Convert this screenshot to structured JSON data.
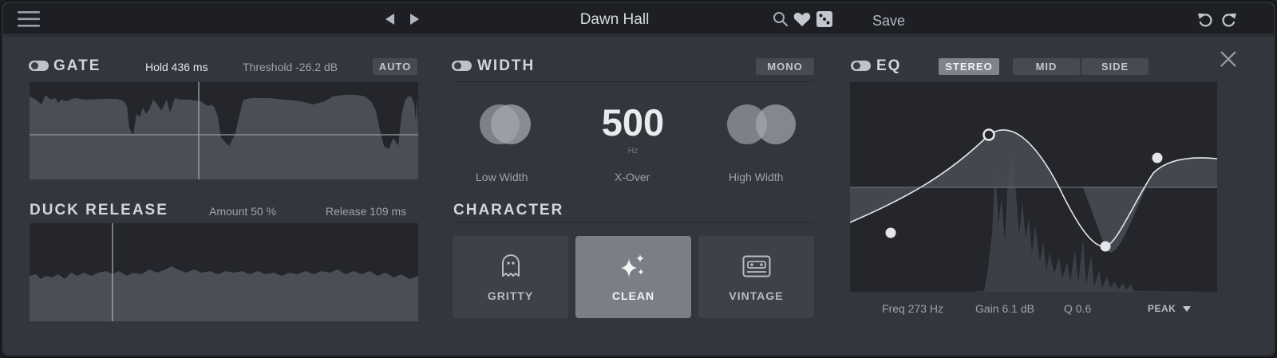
{
  "topbar": {
    "preset_name": "Dawn Hall",
    "save_label": "Save",
    "icons": [
      "menu-icon",
      "prev-preset-icon",
      "next-preset-icon",
      "search-icon",
      "heart-icon",
      "dice-icon",
      "undo-icon",
      "redo-icon"
    ]
  },
  "gate": {
    "title": "GATE",
    "enabled": true,
    "hold": "Hold 436 ms",
    "threshold": "Threshold -26.2 dB",
    "auto_label": "AUTO"
  },
  "duck": {
    "title": "DUCK RELEASE",
    "amount": "Amount 50 %",
    "release": "Release 109 ms"
  },
  "width": {
    "title": "WIDTH",
    "enabled": true,
    "mono_label": "MONO",
    "low_width_label": "Low Width",
    "xover_value": "500",
    "xover_unit": "Hz",
    "xover_label": "X-Over",
    "high_width_label": "High Width"
  },
  "character": {
    "title": "CHARACTER",
    "options": [
      {
        "label": "GRITTY",
        "icon": "ghost-icon",
        "selected": false
      },
      {
        "label": "CLEAN",
        "icon": "sparkles-icon",
        "selected": true
      },
      {
        "label": "VINTAGE",
        "icon": "cassette-icon",
        "selected": false
      }
    ]
  },
  "eq": {
    "title": "EQ",
    "enabled": true,
    "modes": [
      {
        "label": "STEREO",
        "selected": true
      },
      {
        "label": "MID",
        "selected": false
      },
      {
        "label": "SIDE",
        "selected": false
      }
    ],
    "freq": "Freq 273 Hz",
    "gain": "Gain 6.1 dB",
    "q": "Q 0.6",
    "filter_type": "PEAK"
  },
  "colors": {
    "background": "#33363d",
    "panel": "#24262b",
    "accent_text": "#e9ebee",
    "selected_button": "#80838b"
  }
}
